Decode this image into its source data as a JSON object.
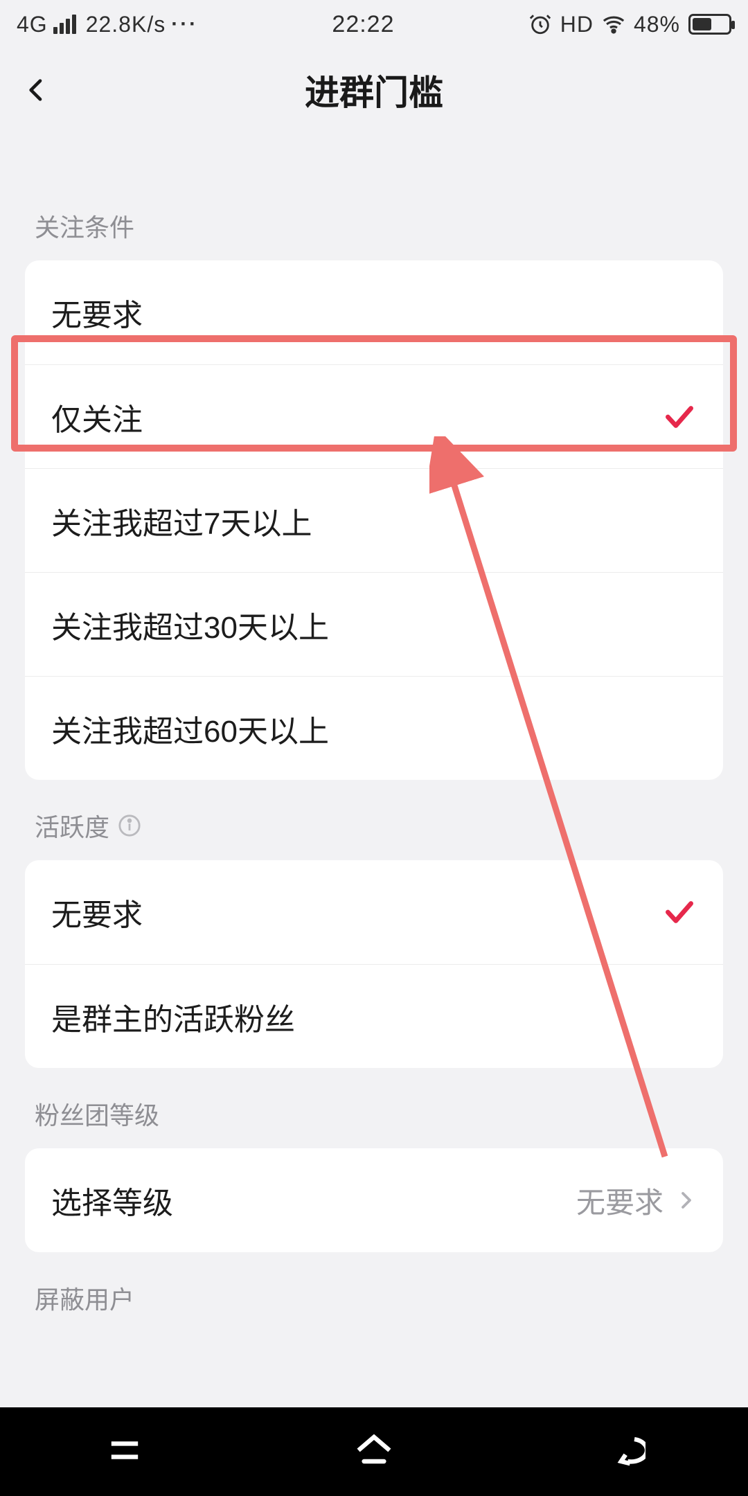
{
  "status_bar": {
    "network_type": "4G",
    "speed": "22.8K/s",
    "time": "22:22",
    "hd": "HD",
    "battery_pct": "48%"
  },
  "header": {
    "title": "进群门槛"
  },
  "sections": {
    "follow": {
      "label": "关注条件",
      "options": [
        "无要求",
        "仅关注",
        "关注我超过7天以上",
        "关注我超过30天以上",
        "关注我超过60天以上"
      ],
      "selected_index": 1
    },
    "activity": {
      "label": "活跃度",
      "options": [
        "无要求",
        "是群主的活跃粉丝"
      ],
      "selected_index": 0
    },
    "fan_level": {
      "label": "粉丝团等级",
      "row_label": "选择等级",
      "value": "无要求"
    },
    "blocked": {
      "label": "屏蔽用户"
    }
  },
  "colors": {
    "accent": "#e6284b",
    "highlight_border": "#ee6f6c"
  }
}
